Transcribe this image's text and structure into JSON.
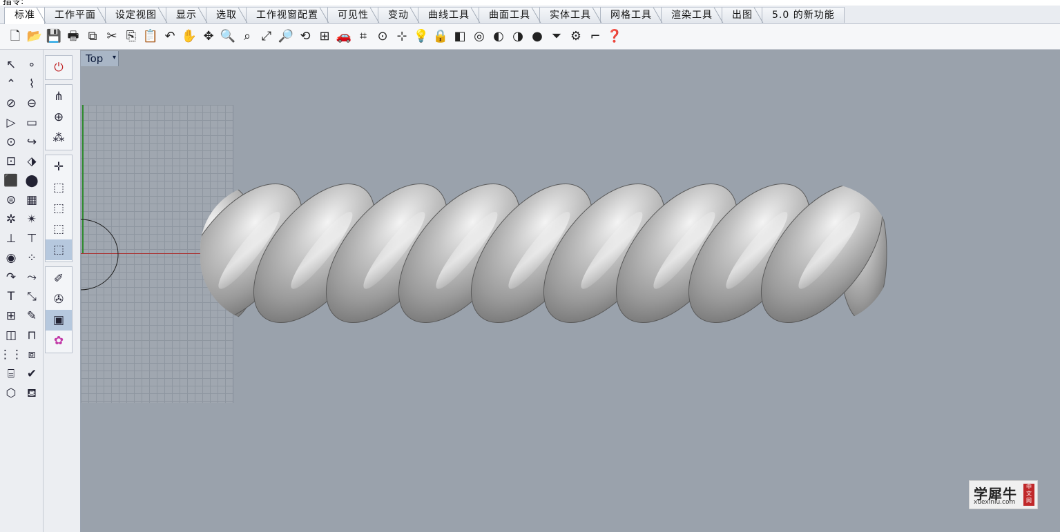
{
  "command": {
    "prompt_label": "指令:"
  },
  "tabs": [
    {
      "label": "标准",
      "active": true
    },
    {
      "label": "工作平面"
    },
    {
      "label": "设定视图"
    },
    {
      "label": "显示"
    },
    {
      "label": "选取"
    },
    {
      "label": "工作视窗配置"
    },
    {
      "label": "可见性"
    },
    {
      "label": "变动"
    },
    {
      "label": "曲线工具"
    },
    {
      "label": "曲面工具"
    },
    {
      "label": "实体工具"
    },
    {
      "label": "网格工具"
    },
    {
      "label": "渲染工具"
    },
    {
      "label": "出图"
    },
    {
      "label": "5.0 的新功能"
    }
  ],
  "toolbar_icons": [
    {
      "name": "new-document",
      "glyph": "🗋"
    },
    {
      "name": "open-folder",
      "glyph": "📂"
    },
    {
      "name": "save",
      "glyph": "💾"
    },
    {
      "name": "print",
      "glyph": "🖶"
    },
    {
      "name": "export",
      "glyph": "⧉"
    },
    {
      "name": "cut",
      "glyph": "✂"
    },
    {
      "name": "copy",
      "glyph": "⎘"
    },
    {
      "name": "paste",
      "glyph": "📋"
    },
    {
      "name": "undo",
      "glyph": "↶"
    },
    {
      "name": "pan-hand",
      "glyph": "✋"
    },
    {
      "name": "rotate-view",
      "glyph": "✥"
    },
    {
      "name": "zoom",
      "glyph": "🔍"
    },
    {
      "name": "zoom-window",
      "glyph": "⌕"
    },
    {
      "name": "zoom-extents",
      "glyph": "⤢"
    },
    {
      "name": "zoom-selected",
      "glyph": "🔎"
    },
    {
      "name": "undo-view",
      "glyph": "⟲"
    },
    {
      "name": "four-viewports",
      "glyph": "⊞"
    },
    {
      "name": "car-properties",
      "glyph": "🚗"
    },
    {
      "name": "object-snap",
      "glyph": "⌗"
    },
    {
      "name": "grid-snap",
      "glyph": "⊙"
    },
    {
      "name": "select-points",
      "glyph": "⊹"
    },
    {
      "name": "light-bulb",
      "glyph": "💡"
    },
    {
      "name": "lock",
      "glyph": "🔒"
    },
    {
      "name": "layer-edit",
      "glyph": "◧"
    },
    {
      "name": "color-wheel",
      "glyph": "◎"
    },
    {
      "name": "render-preview",
      "glyph": "◐"
    },
    {
      "name": "shaded-sphere",
      "glyph": "◑"
    },
    {
      "name": "render-sphere",
      "glyph": "●"
    },
    {
      "name": "filter",
      "glyph": "⏷"
    },
    {
      "name": "settings-gear",
      "glyph": "⚙"
    },
    {
      "name": "dimension",
      "glyph": "⌐"
    },
    {
      "name": "help",
      "glyph": "❓"
    }
  ],
  "left_tools": [
    {
      "name": "select-arrow",
      "glyph": "↖"
    },
    {
      "name": "point",
      "glyph": "∘"
    },
    {
      "name": "polyline",
      "glyph": "⌃"
    },
    {
      "name": "curve-control-points",
      "glyph": "⌇"
    },
    {
      "name": "circle",
      "glyph": "⊘"
    },
    {
      "name": "ellipse",
      "glyph": "⊖"
    },
    {
      "name": "polygon",
      "glyph": "▷"
    },
    {
      "name": "rectangle",
      "glyph": "▭"
    },
    {
      "name": "arc",
      "glyph": "⊙"
    },
    {
      "name": "fillet-curve",
      "glyph": "↪"
    },
    {
      "name": "surface-corner",
      "glyph": "⊡"
    },
    {
      "name": "extrude-surface",
      "glyph": "⬗"
    },
    {
      "name": "box-solid",
      "glyph": "⬛"
    },
    {
      "name": "boolean-union",
      "glyph": "⬤"
    },
    {
      "name": "cylinder",
      "glyph": "⊜"
    },
    {
      "name": "mesh",
      "glyph": "▦"
    },
    {
      "name": "gear-transform",
      "glyph": "✲"
    },
    {
      "name": "explode",
      "glyph": "✴"
    },
    {
      "name": "split",
      "glyph": "⊥"
    },
    {
      "name": "trim",
      "glyph": "⊤"
    },
    {
      "name": "boolean-difference",
      "glyph": "◉"
    },
    {
      "name": "boolean-intersect",
      "glyph": "⁘"
    },
    {
      "name": "offset-curve",
      "glyph": "↷"
    },
    {
      "name": "blend-curve",
      "glyph": "⤳"
    },
    {
      "name": "text",
      "glyph": "T"
    },
    {
      "name": "scale",
      "glyph": "⤡"
    },
    {
      "name": "array",
      "glyph": "⊞"
    },
    {
      "name": "edit-pencil",
      "glyph": "✎"
    },
    {
      "name": "solid-box-blue",
      "glyph": "◫"
    },
    {
      "name": "dimension-bar",
      "glyph": "⊓"
    },
    {
      "name": "grid-array",
      "glyph": "⋮⋮"
    },
    {
      "name": "group",
      "glyph": "⧈"
    },
    {
      "name": "analyze",
      "glyph": "⌸"
    },
    {
      "name": "checkmark",
      "glyph": "✔"
    },
    {
      "name": "render-objects",
      "glyph": "⬡"
    },
    {
      "name": "paint-bucket",
      "glyph": "⛾"
    }
  ],
  "side_tool_groups": [
    [
      {
        "name": "power",
        "glyph": "⏻",
        "color": "#c0282a"
      }
    ],
    [
      {
        "name": "cplane-axes",
        "glyph": "⋔"
      },
      {
        "name": "globe-view",
        "glyph": "⊕"
      },
      {
        "name": "network-nodes",
        "glyph": "⁂"
      }
    ],
    [
      {
        "name": "gumball-axes",
        "glyph": "✛"
      },
      {
        "name": "cube-view-1",
        "glyph": "⬚"
      },
      {
        "name": "cube-view-2",
        "glyph": "⬚"
      },
      {
        "name": "cube-view-3",
        "glyph": "⬚"
      },
      {
        "name": "cube-view-4",
        "glyph": "⬚",
        "selected": true
      }
    ],
    [
      {
        "name": "pen-tool",
        "glyph": "✐"
      },
      {
        "name": "brush-tool",
        "glyph": "✇"
      },
      {
        "name": "h-button",
        "glyph": "▣",
        "selected": true
      },
      {
        "name": "pink-gear",
        "glyph": "✿",
        "color": "#c23aa8"
      }
    ]
  ],
  "viewport": {
    "label": "Top",
    "background": "#9aa2ac"
  },
  "watermark": {
    "chinese": "学犀牛",
    "url": "xuexiniu.com",
    "seal": "中文网"
  }
}
